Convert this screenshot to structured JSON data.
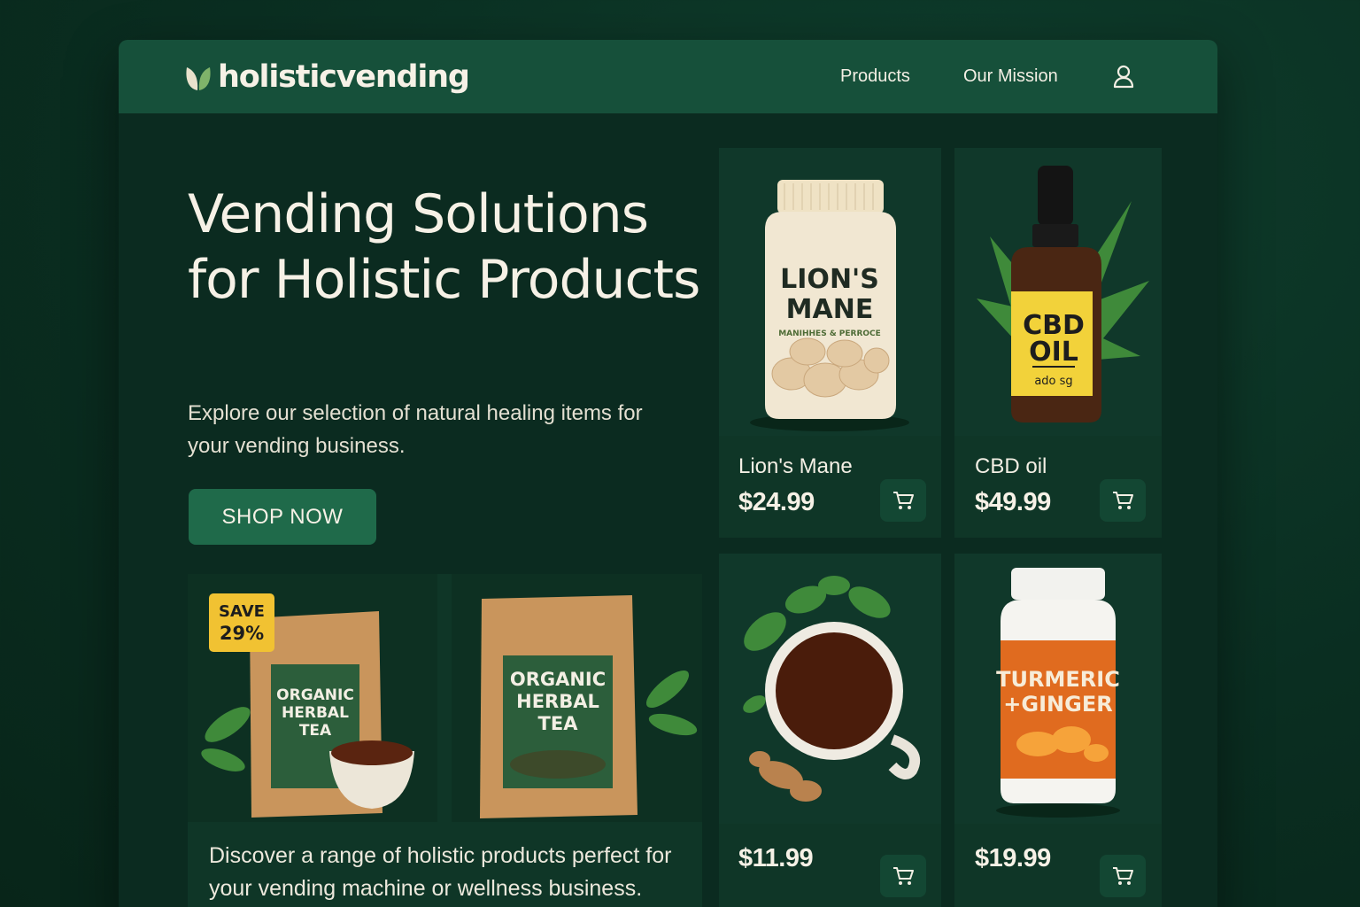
{
  "header": {
    "logo_text": "holisticvending",
    "nav": [
      {
        "label": "Products"
      },
      {
        "label": "Our Mission"
      }
    ],
    "account_icon": "user-icon"
  },
  "hero": {
    "title": "Vending Solutions for Holistic Products",
    "subtitle": "Explore our selection of natural healing items for your vending business.",
    "cta_label": "SHOP NOW"
  },
  "products": [
    {
      "name": "Lion's Mane",
      "price": "$24.99",
      "label_line1": "LION'S",
      "label_line2": "MANE",
      "label_small": "MANIHHES & PERROCE"
    },
    {
      "name": "CBD oil",
      "price": "$49.99",
      "label_line1": "CBD",
      "label_line2": "OIL",
      "label_small": "ado sg"
    },
    {
      "name": "",
      "price": "$11.99"
    },
    {
      "name": "",
      "price": "$19.99",
      "label_line1": "TURMERIC",
      "label_line2": "+GINGER"
    }
  ],
  "tea": {
    "badge_line1": "SAVE",
    "badge_line2": "29%",
    "pouch_label_lines": [
      "ORGANIC",
      "HERBAL",
      "TEA"
    ],
    "description": "Discover a range of holistic products perfect for your vending machine or wellness business."
  },
  "colors": {
    "background": "#0a2e21",
    "topbar": "#16503a",
    "button": "#1f6a4a",
    "card": "#0f3627",
    "badge": "#f1c232"
  }
}
